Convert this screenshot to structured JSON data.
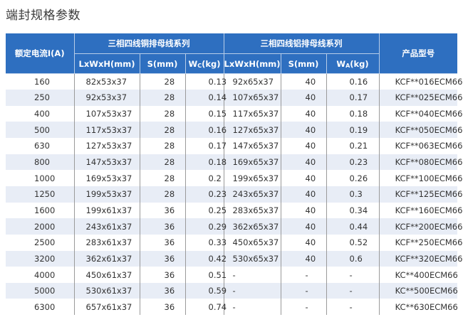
{
  "page_title": "端封规格参数",
  "table": {
    "header": {
      "rated_current": "额定电流I(A)",
      "copper_group": "三相四线铜排母线系列",
      "aluminum_group": "三相四线铝排母线系列",
      "product_model": "产品型号",
      "copper_cols": {
        "size": "LxWxH(mm)",
        "s": "S(mm)",
        "w_main": "W",
        "w_sub": "C",
        "w_unit": "(kg)"
      },
      "aluminum_cols": {
        "size": "LxWxH(mm)",
        "s": "S(mm)",
        "w_main": "W",
        "w_sub": "A",
        "w_unit": "(kg)"
      }
    },
    "rows": [
      [
        "160",
        "82x53x37",
        "28",
        "0.13",
        "92x65x37",
        "40",
        "0.16",
        "KCF**016ECM66"
      ],
      [
        "250",
        "92x53x37",
        "28",
        "0.14",
        "107x65x37",
        "40",
        "0.17",
        "KCF**025ECM66"
      ],
      [
        "400",
        "107x53x37",
        "28",
        "0.15",
        "117x65x37",
        "40",
        "0.18",
        "KCF**040ECM66"
      ],
      [
        "500",
        "117x53x37",
        "28",
        "0.16",
        "127x65x37",
        "40",
        "0.19",
        "KCF**050ECM66"
      ],
      [
        "630",
        "127x53x37",
        "28",
        "0.17",
        "147x65x37",
        "40",
        "0.21",
        "KCF**063ECM66"
      ],
      [
        "800",
        "147x53x37",
        "28",
        "0.18",
        "169x65x37",
        "40",
        "0.23",
        "KCF**080ECM66"
      ],
      [
        "1000",
        "169x53x37",
        "28",
        "0.2",
        "199x65x37",
        "40",
        "0.26",
        "KCF**100ECM66"
      ],
      [
        "1250",
        "199x53x37",
        "28",
        "0.23",
        "243x65x37",
        "40",
        "0.3",
        "KCF**125ECM66"
      ],
      [
        "1600",
        "199x61x37",
        "36",
        "0.25",
        "283x65x37",
        "40",
        "0.34",
        "KCF**160ECM66"
      ],
      [
        "2000",
        "243x61x37",
        "36",
        "0.29",
        "362x65x37",
        "40",
        "0.44",
        "KCF**200ECM66"
      ],
      [
        "2500",
        "283x61x37",
        "36",
        "0.33",
        "450x65x37",
        "40",
        "0.52",
        "KCF**250ECM66"
      ],
      [
        "3200",
        "362x61x37",
        "36",
        "0.42",
        "530x65x37",
        "40",
        "0.6",
        "KCF**320ECM66"
      ],
      [
        "4000",
        "450x61x37",
        "36",
        "0.51",
        "-",
        "-",
        "-",
        "KC**400ECM66"
      ],
      [
        "5000",
        "530x61x37",
        "36",
        "0.59",
        "-",
        "-",
        "-",
        "KC**500ECM66"
      ],
      [
        "6300",
        "657x61x37",
        "36",
        "0.74",
        "-",
        "-",
        "-",
        "KC**630ECM66"
      ]
    ]
  },
  "colors": {
    "header_bg": "#2e6fc0",
    "row_alt_bg": "#e8edf6"
  }
}
